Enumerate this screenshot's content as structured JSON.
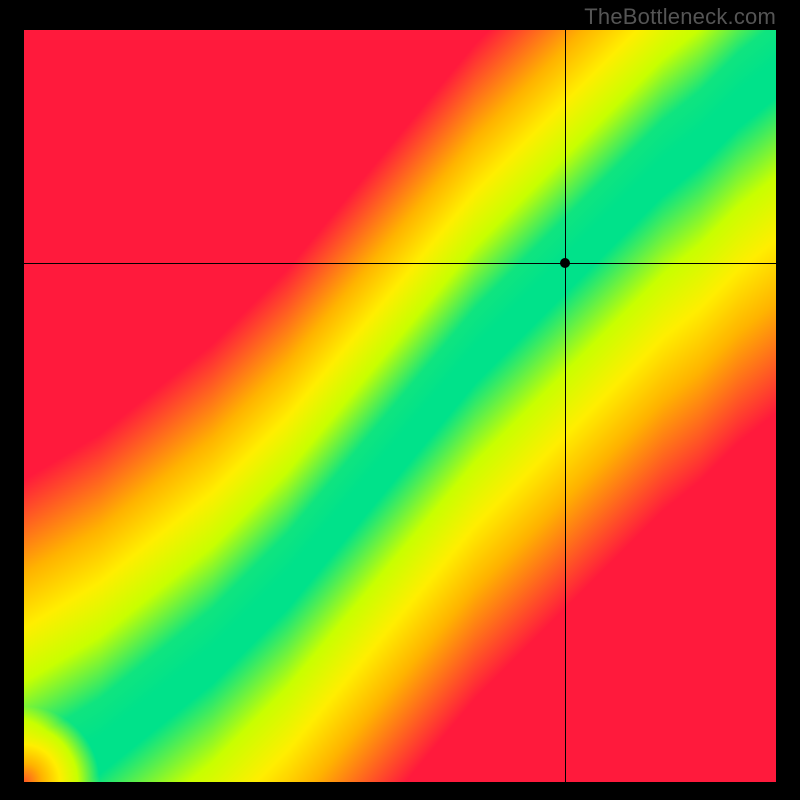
{
  "watermark": "TheBottleneck.com",
  "chart_data": {
    "type": "heatmap",
    "title": "",
    "xlabel": "",
    "ylabel": "",
    "xlim": [
      0,
      100
    ],
    "ylim": [
      0,
      100
    ],
    "crosshair": {
      "x": 72,
      "y": 69
    },
    "colorscale": [
      {
        "stop": 0.0,
        "color": "#ff1a3c"
      },
      {
        "stop": 0.35,
        "color": "#ffb300"
      },
      {
        "stop": 0.55,
        "color": "#ffee00"
      },
      {
        "stop": 0.75,
        "color": "#c8ff00"
      },
      {
        "stop": 1.0,
        "color": "#00e28a"
      }
    ],
    "ridge": {
      "comment": "y = f(x) centerline of the green optimal band, values 0-100",
      "x": [
        0,
        5,
        10,
        15,
        20,
        25,
        30,
        35,
        40,
        45,
        50,
        55,
        60,
        65,
        70,
        75,
        80,
        85,
        90,
        95,
        100
      ],
      "y": [
        0,
        3,
        6,
        10,
        14,
        18,
        23,
        28,
        34,
        40,
        46,
        52,
        58,
        63,
        68,
        73,
        78,
        83,
        87,
        92,
        96
      ]
    },
    "band_halfwidth": 5,
    "grid": false,
    "legend": null
  }
}
